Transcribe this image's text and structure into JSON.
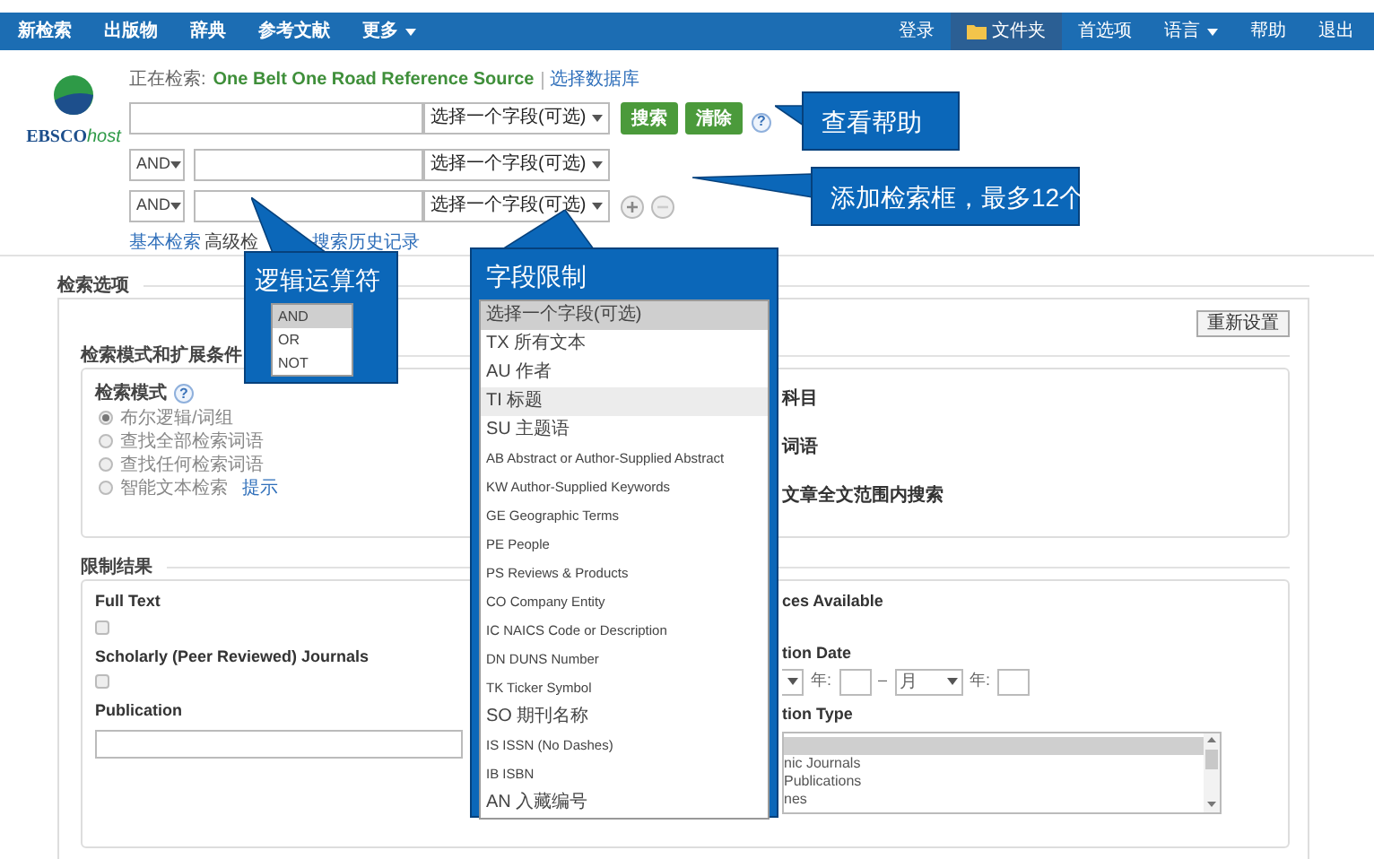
{
  "nav": {
    "left": [
      {
        "label": "新检索",
        "kind": "plain"
      },
      {
        "label": "出版物",
        "kind": "plain"
      },
      {
        "label": "辞典",
        "kind": "plain"
      },
      {
        "label": "参考文献",
        "kind": "plain"
      },
      {
        "label": "更多",
        "kind": "menu"
      }
    ],
    "right": [
      {
        "label": "登录",
        "kind": "plain"
      },
      {
        "label": "文件夹",
        "kind": "folder"
      },
      {
        "label": "首选项",
        "kind": "plain"
      },
      {
        "label": "语言",
        "kind": "menu"
      },
      {
        "label": "帮助",
        "kind": "plain"
      },
      {
        "label": "退出",
        "kind": "plain"
      }
    ]
  },
  "logo": {
    "text": "EBSCO",
    "suffix": "host"
  },
  "searching": {
    "label": "正在检索:",
    "database": "One Belt One Road Reference Source",
    "link": "选择数据库"
  },
  "search_rows": [
    {
      "field": "选择一个字段(可选)"
    },
    {
      "operator": "AND",
      "field": "选择一个字段(可选)"
    },
    {
      "operator": "AND",
      "field": "选择一个字段(可选)"
    }
  ],
  "buttons": [
    {
      "label": "搜索"
    },
    {
      "label": "清除"
    }
  ],
  "help": "?",
  "links": [
    {
      "label": "基本检索",
      "kind": "link"
    },
    {
      "label": "高级检",
      "kind": "current"
    },
    {
      "label": "搜索历史记录",
      "kind": "link"
    }
  ],
  "options": {
    "title": "检索选项",
    "reset": "重新设置",
    "modes_title": "检索模式和扩展条件",
    "mode_label": "检索模式",
    "help": "?",
    "radios": [
      {
        "label": "布尔逻辑/词组",
        "selected": true
      },
      {
        "label": "查找全部检索词语",
        "selected": false
      },
      {
        "label": "查找任何检索词语",
        "selected": false
      },
      {
        "label": "智能文本检索",
        "selected": false,
        "hint": "提示"
      }
    ],
    "right": [
      "科目",
      "词语",
      "文章全文范围内搜索"
    ]
  },
  "limits": {
    "title": "限制结果",
    "left": [
      {
        "kind": "checkbox",
        "label": "Full Text",
        "checked": false
      },
      {
        "kind": "checkbox",
        "label": "Scholarly (Peer Reviewed) Journals",
        "checked": false
      },
      {
        "kind": "text",
        "label": "Publication"
      }
    ],
    "available": "ces Available",
    "date_label": "tion Date",
    "date": {
      "year1": "年:",
      "dash": "–",
      "month": "月",
      "year2": "年:"
    },
    "type_label": "tion Type",
    "types": [
      {
        "selected": true
      },
      {
        "label": "nic Journals",
        "selected": false
      },
      {
        "label": "Publications",
        "selected": false
      },
      {
        "label": "nes",
        "selected": false
      }
    ]
  },
  "callouts": [
    {
      "kind": "help",
      "text": "查看帮助"
    },
    {
      "kind": "add",
      "text": "添加检索框，最多12个"
    },
    {
      "kind": "operator",
      "text": "逻辑运算符",
      "options": [
        {
          "label": "AND",
          "selected": true
        },
        {
          "label": "OR",
          "selected": false
        },
        {
          "label": "NOT",
          "selected": false
        }
      ]
    },
    {
      "kind": "field",
      "text": "字段限制",
      "options": [
        {
          "label": "选择一个字段(可选)",
          "selected": true,
          "highlighted": false
        },
        {
          "label": "TX 所有文本",
          "selected": false,
          "highlighted": false
        },
        {
          "label": "AU 作者",
          "selected": false,
          "highlighted": false
        },
        {
          "label": "TI 标题",
          "selected": false,
          "highlighted": true
        },
        {
          "label": "SU 主题语",
          "selected": false,
          "highlighted": false
        },
        {
          "label": "AB Abstract or Author-Supplied Abstract",
          "selected": false,
          "highlighted": false
        },
        {
          "label": "KW Author-Supplied Keywords",
          "selected": false,
          "highlighted": false
        },
        {
          "label": "GE Geographic Terms",
          "selected": false,
          "highlighted": false
        },
        {
          "label": "PE People",
          "selected": false,
          "highlighted": false
        },
        {
          "label": "PS Reviews & Products",
          "selected": false,
          "highlighted": false
        },
        {
          "label": "CO Company Entity",
          "selected": false,
          "highlighted": false
        },
        {
          "label": "IC NAICS Code or Description",
          "selected": false,
          "highlighted": false
        },
        {
          "label": "DN DUNS Number",
          "selected": false,
          "highlighted": false
        },
        {
          "label": "TK Ticker Symbol",
          "selected": false,
          "highlighted": false
        },
        {
          "label": "SO 期刊名称",
          "selected": false,
          "highlighted": false
        },
        {
          "label": "IS ISSN (No Dashes)",
          "selected": false,
          "highlighted": false
        },
        {
          "label": "IB ISBN",
          "selected": false,
          "highlighted": false
        },
        {
          "label": "AN 入藏编号",
          "selected": false,
          "highlighted": false
        }
      ]
    }
  ]
}
